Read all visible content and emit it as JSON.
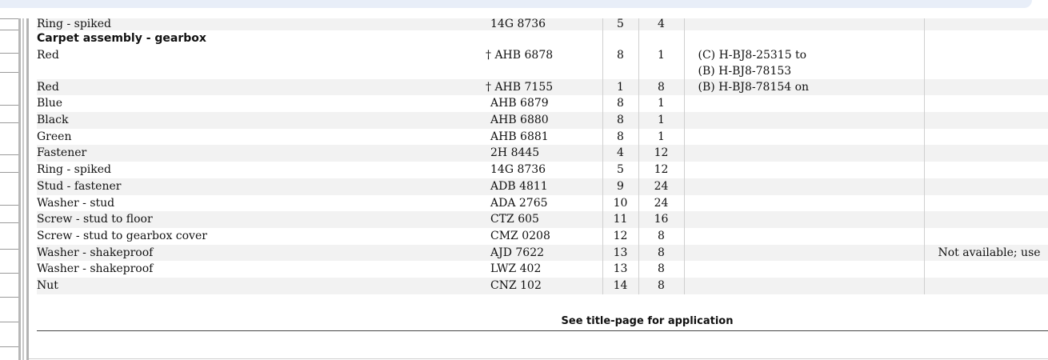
{
  "rows": [
    {
      "description": "Ring - spiked",
      "indent": 1,
      "part_no": "14G 8736",
      "illus": "5",
      "qty": "4",
      "change": "",
      "remarks": "",
      "style": "alt",
      "clip": true
    },
    {
      "description": "Carpet assembly - gearbox",
      "indent": 0,
      "header": true,
      "part_no": "",
      "illus": "",
      "qty": "",
      "change": "",
      "remarks": "",
      "style": "plain"
    },
    {
      "description": "Red",
      "indent": 2,
      "part_no": "† AHB 6878",
      "illus": "8",
      "qty": "1",
      "change": "(C) H-BJ8-25315 to",
      "change2": "(B) H-BJ8-78153",
      "remarks": "",
      "style": "plain",
      "tall": true
    },
    {
      "description": "Red",
      "indent": 2,
      "part_no": "† AHB 7155",
      "illus": "1",
      "qty": "8",
      "change": "(B) H-BJ8-78154 on",
      "remarks": "",
      "style": "alt"
    },
    {
      "description": "Blue",
      "indent": 2,
      "part_no": "AHB 6879",
      "illus": "8",
      "qty": "1",
      "change": "",
      "remarks": "",
      "style": "plain"
    },
    {
      "description": "Black",
      "indent": 2,
      "part_no": "AHB 6880",
      "illus": "8",
      "qty": "1",
      "change": "",
      "remarks": "",
      "style": "alt"
    },
    {
      "description": "Green",
      "indent": 2,
      "part_no": "AHB 6881",
      "illus": "8",
      "qty": "1",
      "change": "",
      "remarks": "",
      "style": "plain"
    },
    {
      "description": "Fastener",
      "indent": 1,
      "part_no": "2H 8445",
      "illus": "4",
      "qty": "12",
      "change": "",
      "remarks": "",
      "style": "alt"
    },
    {
      "description": "Ring - spiked",
      "indent": 1,
      "part_no": "14G 8736",
      "illus": "5",
      "qty": "12",
      "change": "",
      "remarks": "",
      "style": "plain"
    },
    {
      "description": "Stud - fastener",
      "indent": 0,
      "part_no": "ADB 4811",
      "illus": "9",
      "qty": "24",
      "change": "",
      "remarks": "",
      "style": "alt"
    },
    {
      "description": "Washer - stud",
      "indent": 0,
      "part_no": "ADA 2765",
      "illus": "10",
      "qty": "24",
      "change": "",
      "remarks": "",
      "style": "plain"
    },
    {
      "description": "Screw - stud to floor",
      "indent": 0,
      "part_no": "CTZ 605",
      "illus": "11",
      "qty": "16",
      "change": "",
      "remarks": "",
      "style": "alt"
    },
    {
      "description": "Screw - stud to gearbox cover",
      "indent": 0,
      "part_no": "CMZ 0208",
      "illus": "12",
      "qty": "8",
      "change": "",
      "remarks": "",
      "style": "plain"
    },
    {
      "description": "Washer - shakeproof",
      "indent": 0,
      "part_no": "AJD 7622",
      "illus": "13",
      "qty": "8",
      "change": "",
      "remarks": "Not available; use",
      "style": "alt"
    },
    {
      "description": "Washer - shakeproof",
      "indent": 0,
      "part_no": "LWZ 402",
      "illus": "13",
      "qty": "8",
      "change": "",
      "remarks": "",
      "style": "plain"
    },
    {
      "description": "Nut",
      "indent": 0,
      "part_no": "CNZ 102",
      "illus": "14",
      "qty": "8",
      "change": "",
      "remarks": "",
      "style": "alt"
    }
  ],
  "footer": {
    "text": "See title-page for application"
  }
}
